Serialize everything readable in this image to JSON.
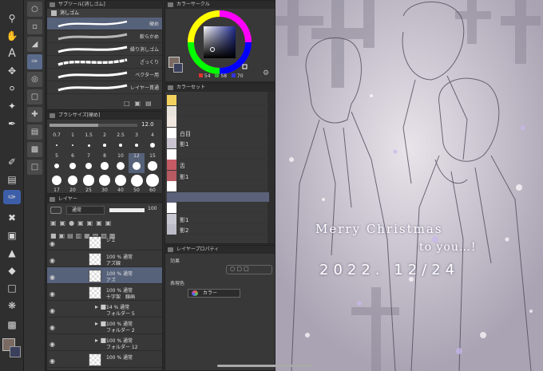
{
  "subtool_panel": {
    "title": "サブツール[消しゴム]",
    "group_label": "消しゴム",
    "brushes": [
      {
        "label": "硬め",
        "selected": true
      },
      {
        "label": "軟らかめ",
        "selected": false
      },
      {
        "label": "縁り消しゴム",
        "selected": false
      },
      {
        "label": "ざっくり",
        "selected": false
      },
      {
        "label": "ベクター用",
        "selected": false
      },
      {
        "label": "レイヤー貫通",
        "selected": false
      }
    ]
  },
  "brush_size_panel": {
    "title": "ブラシサイズ[硬め]",
    "value": "12.0",
    "sizes": [
      "0.7",
      "1",
      "1.5",
      "2",
      "2.5",
      "3",
      "4",
      "5",
      "6",
      "7",
      "8",
      "10",
      "12",
      "15",
      "17",
      "20",
      "25",
      "30",
      "40",
      "50",
      "60"
    ],
    "selected_size": "12"
  },
  "color_circle": {
    "title": "カラーサークル",
    "h": "54",
    "s": "58",
    "v": "70",
    "h_label": "H",
    "s_label": "S",
    "v_label": "V",
    "accent": "#5a5a78"
  },
  "color_set": {
    "title": "カラーセット",
    "rows": [
      {
        "name": "",
        "color": "#f2d35e"
      },
      {
        "name": "",
        "color": "#e8e4dc"
      },
      {
        "name": "",
        "color": "#f0e8e0"
      },
      {
        "name": "白目",
        "color": "#ffffff"
      },
      {
        "name": "影1",
        "color": "#c9c4d0"
      },
      {
        "name": "",
        "color": "#ffffff"
      },
      {
        "name": "舌",
        "color": "#c45a64"
      },
      {
        "name": "影1",
        "color": "#b85a62"
      },
      {
        "name": "",
        "color": "#ffffff"
      },
      {
        "name": "",
        "color": "#5a6178"
      },
      {
        "name": "",
        "color": "#ffffff"
      },
      {
        "name": "影1",
        "color": "#c8c8d2"
      },
      {
        "name": "影2",
        "color": "#bcbcc8"
      }
    ]
  },
  "layer_panel": {
    "title": "レイヤー",
    "blend_mode": "通常",
    "opacity": "100",
    "layers": [
      {
        "line1": "ジェ",
        "line2": "",
        "selected": false,
        "folder": false
      },
      {
        "line1": "100 % 通常",
        "line2": "アズ線",
        "selected": false,
        "folder": false
      },
      {
        "line1": "100 % 通常",
        "line2": "アズ",
        "selected": true,
        "folder": false
      },
      {
        "line1": "100 % 通常",
        "line2": "十字架　線画",
        "selected": false,
        "folder": false
      },
      {
        "line1": "14 % 通常",
        "line2": "フォルダー 5",
        "selected": false,
        "folder": true
      },
      {
        "line1": "100 % 通常",
        "line2": "フォルダー 2",
        "selected": false,
        "folder": true
      },
      {
        "line1": "100 % 通常",
        "line2": "フォルダー 12",
        "selected": false,
        "folder": true
      },
      {
        "line1": "100 % 通常",
        "line2": "",
        "selected": false,
        "folder": false
      }
    ]
  },
  "layer_property": {
    "title": "レイヤープロパティ",
    "effect_label": "効果",
    "display_color_label": "表現色",
    "display_color_value": "カラー"
  },
  "artwork": {
    "greeting_line1": "Merry Christmas",
    "greeting_line2": "to you…!",
    "date": "2022. 12/24"
  }
}
